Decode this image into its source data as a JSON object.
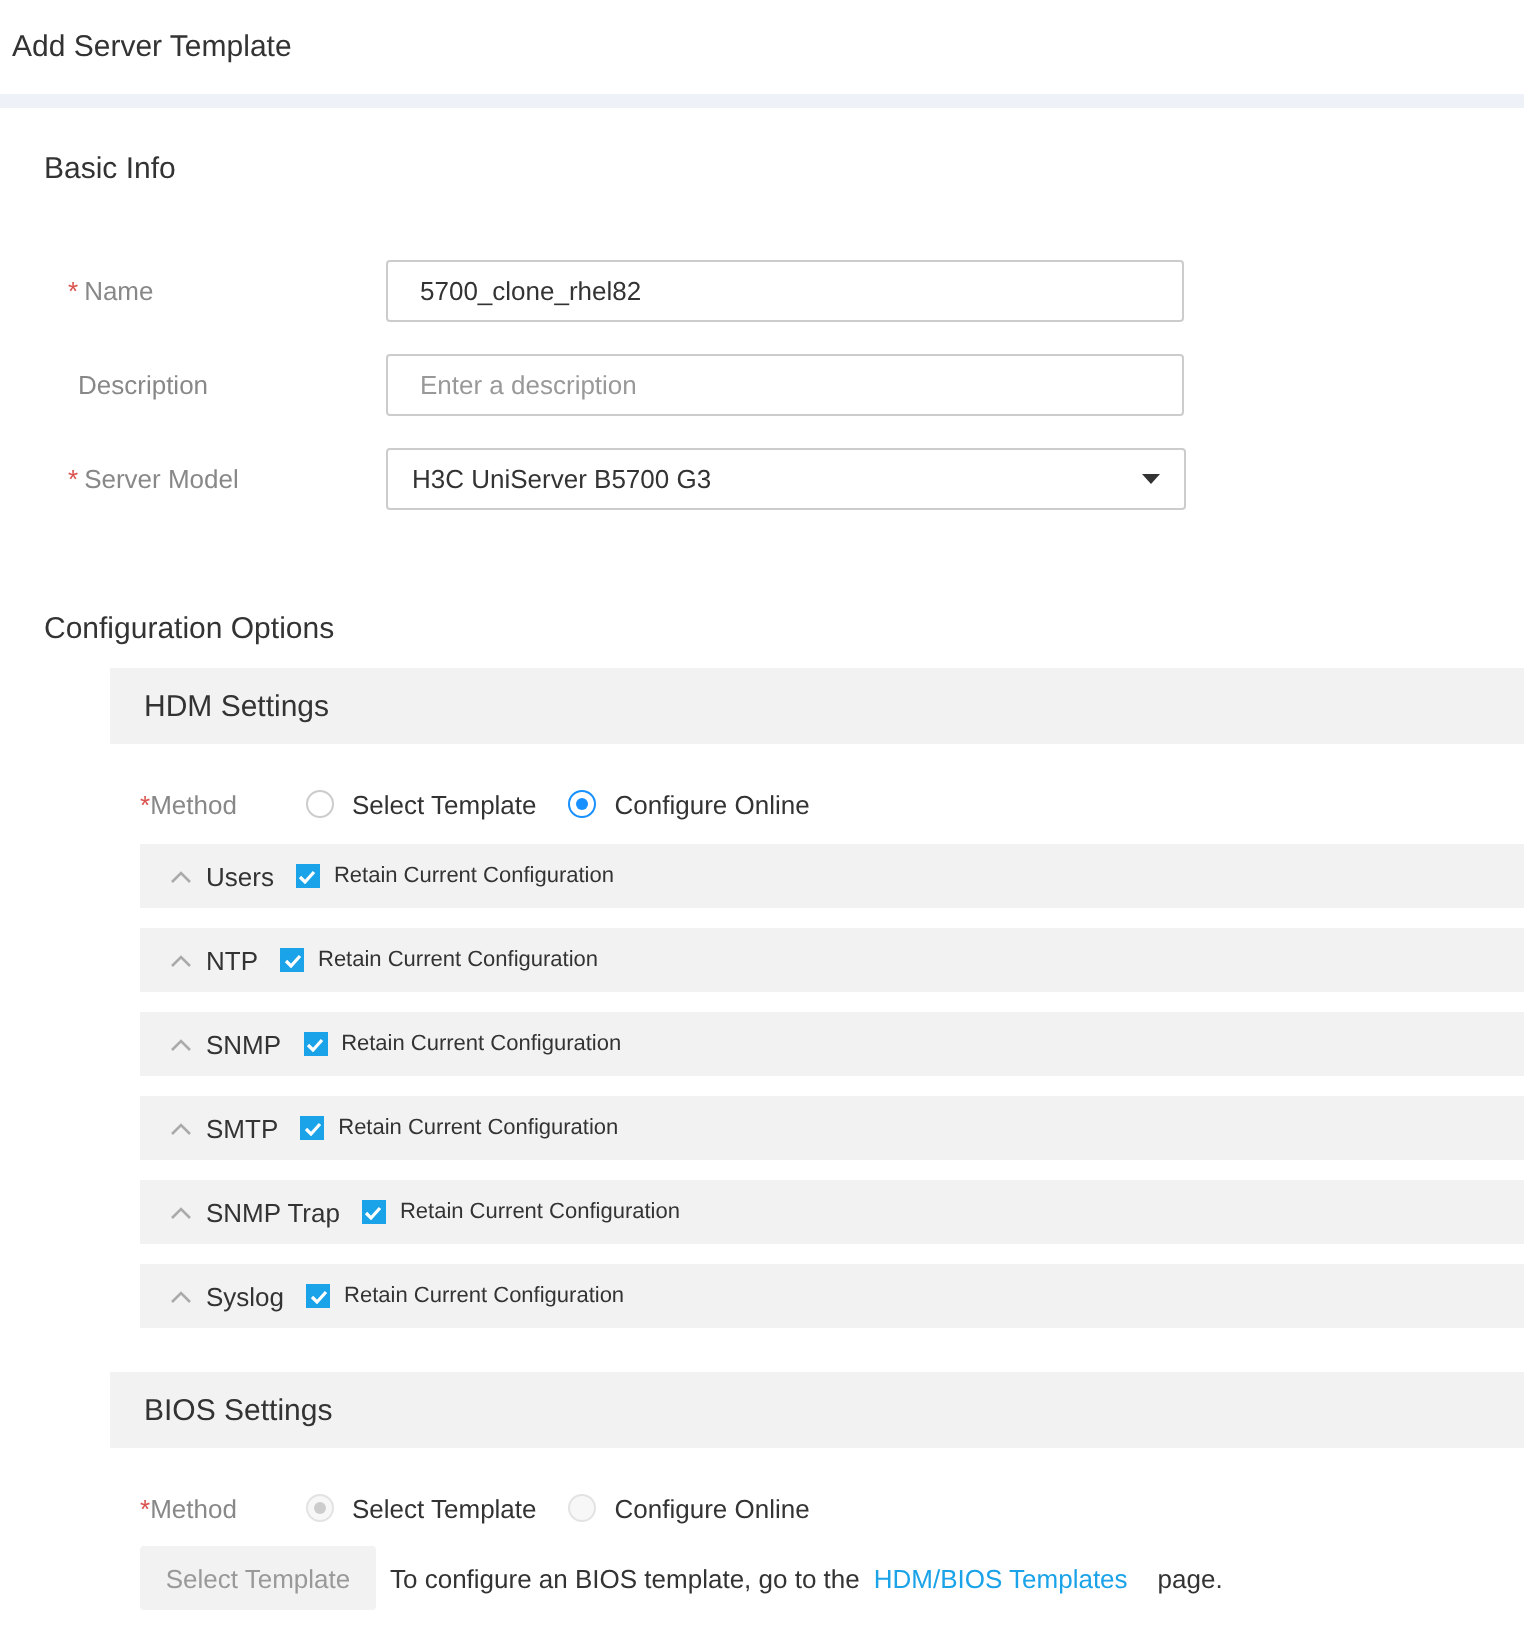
{
  "page_title": "Add Server Template",
  "basic_info": {
    "title": "Basic Info",
    "fields": [
      {
        "label": "Name",
        "required_mark": "*",
        "kind": "input",
        "value": "5700_clone_rhel82"
      },
      {
        "label": "Description",
        "kind": "input",
        "placeholder": "Enter a description"
      },
      {
        "label": "Server Model",
        "required_mark": "*",
        "kind": "select",
        "value": "H3C UniServer B5700 G3"
      }
    ]
  },
  "configuration_options": {
    "title": "Configuration Options",
    "hdm_settings": {
      "title": "HDM Settings",
      "method": {
        "required_mark": "*",
        "label": "Method",
        "disabled": false,
        "options": [
          {
            "label": "Select Template",
            "selected": false
          },
          {
            "label": "Configure Online",
            "selected": true
          }
        ]
      },
      "sections": [
        {
          "title": "Users",
          "expanded": true,
          "checkbox": {
            "label": "Retain Current Configuration",
            "checked": true
          }
        },
        {
          "title": "NTP",
          "expanded": true,
          "checkbox": {
            "label": "Retain Current Configuration",
            "checked": true
          }
        },
        {
          "title": "SNMP",
          "expanded": true,
          "checkbox": {
            "label": "Retain Current Configuration",
            "checked": true
          }
        },
        {
          "title": "SMTP",
          "expanded": true,
          "checkbox": {
            "label": "Retain Current Configuration",
            "checked": true
          }
        },
        {
          "title": "SNMP Trap",
          "expanded": true,
          "checkbox": {
            "label": "Retain Current Configuration",
            "checked": true
          }
        },
        {
          "title": "Syslog",
          "expanded": true,
          "checkbox": {
            "label": "Retain Current Configuration",
            "checked": true
          }
        }
      ]
    },
    "bios_settings": {
      "title": "BIOS Settings",
      "method": {
        "required_mark": "*",
        "label": "Method",
        "disabled": true,
        "options": [
          {
            "label": "Select Template",
            "selected": true
          },
          {
            "label": "Configure Online",
            "selected": false
          }
        ]
      },
      "select_button": {
        "label": "Select Template",
        "disabled": true
      },
      "hint": {
        "before": "To configure an BIOS template, go to the",
        "link": "HDM/BIOS Templates",
        "after": "page."
      }
    }
  }
}
